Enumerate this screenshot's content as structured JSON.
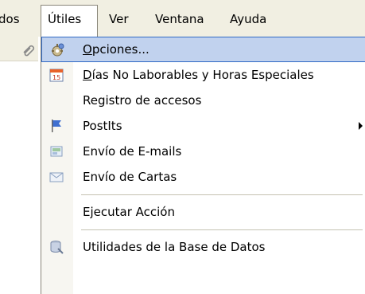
{
  "menubar": {
    "items": [
      "dos",
      "Útiles",
      "Ver",
      "Ventana",
      "Ayuda"
    ],
    "active": "Útiles"
  },
  "menu": {
    "items": [
      {
        "label": "Opciones...",
        "icon": "gear-icon",
        "selected": true
      },
      {
        "label": "Días No Laborables y Horas Especiales",
        "icon": "calendar-icon"
      },
      {
        "label": "Registro de accesos",
        "icon": ""
      },
      {
        "label": "PostIts",
        "icon": "flag-icon",
        "submenu": true
      },
      {
        "label": "Envío de E-mails",
        "icon": "email-screen-icon"
      },
      {
        "label": "Envío de Cartas",
        "icon": "envelope-icon"
      },
      {
        "label": "Ejecutar Acción",
        "icon": ""
      },
      {
        "label": "Utilidades de la Base de Datos",
        "icon": "database-tools-icon"
      }
    ]
  },
  "colors": {
    "menubar_bg": "#f1efe2",
    "highlight_bg": "#c1d2ee",
    "highlight_border": "#316ac5",
    "gutter_bg": "#f7f6f1"
  }
}
